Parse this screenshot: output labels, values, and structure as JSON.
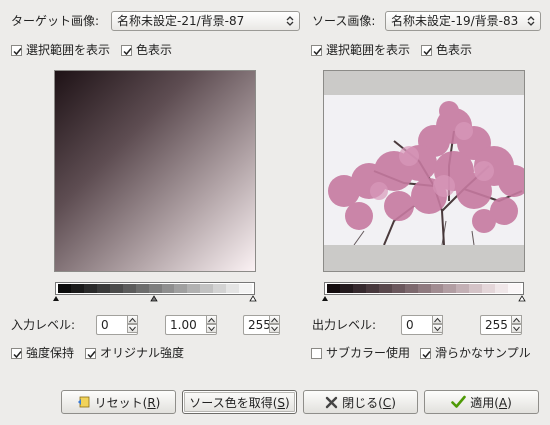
{
  "target": {
    "image_label": "ターゲット画像:",
    "image_value": "名称未設定-21/背景-87",
    "show_selection": "選択範囲を表示",
    "show_color": "色表示",
    "input_level_label": "入力レベル:",
    "input_low": "0",
    "input_gamma": "1.00",
    "input_high": "255",
    "hold_intensity": "強度保持",
    "original_intensity": "オリジナル強度"
  },
  "source": {
    "image_label": "ソース画像:",
    "image_value": "名称未設定-19/背景-83",
    "show_selection": "選択範囲を表示",
    "show_color": "色表示",
    "output_level_label": "出力レベル:",
    "output_low": "0",
    "output_high": "255",
    "use_subcolors": "サブカラー使用",
    "smooth_samples": "滑らかなサンプル",
    "use_subcolors_checked": false,
    "smooth_samples_checked": true
  },
  "buttons": {
    "reset": "リセット(",
    "reset_key": "R",
    "get_source": "ソース色を取得(",
    "get_source_key": "S",
    "close": "閉じる(",
    "close_key": "C",
    "apply": "適用(",
    "apply_key": "A"
  },
  "colors": {
    "target_dark": "#2a1b1f",
    "target_light": "#f7eef0",
    "blossom": "#c77aa0",
    "sky": "#f3f2f5"
  },
  "icons": {
    "reset": "reset-icon",
    "close": "close-x-icon",
    "apply": "checkmark-icon",
    "dropdown": "updown-arrows-icon"
  }
}
